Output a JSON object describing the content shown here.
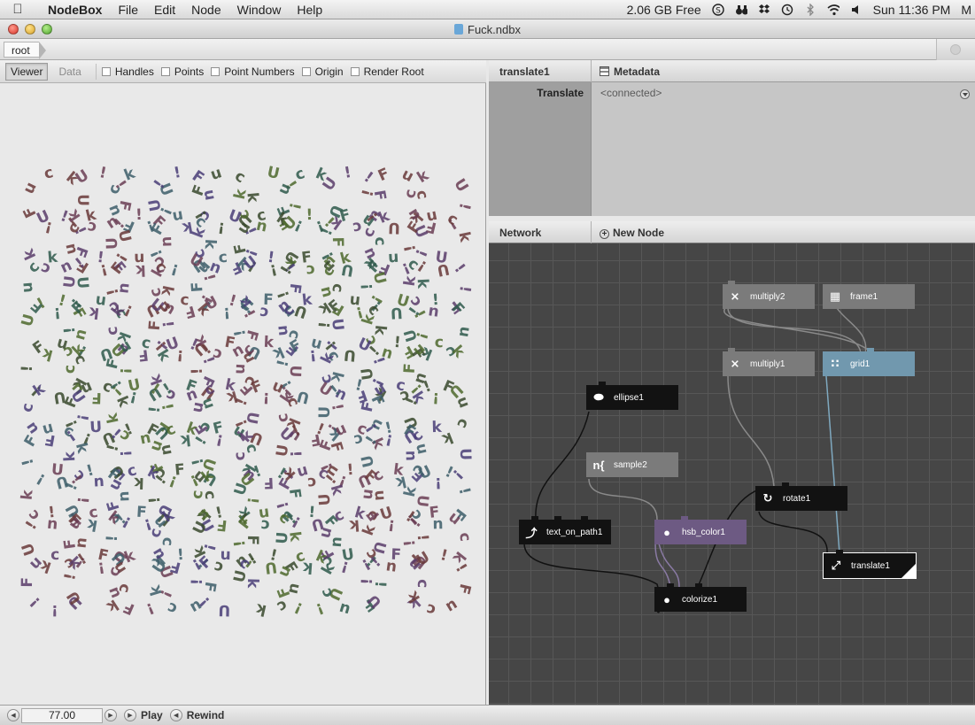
{
  "menubar": {
    "app_name": "NodeBox",
    "menus": [
      "File",
      "Edit",
      "Node",
      "Window",
      "Help"
    ],
    "memory": "2.06 GB Free",
    "clock": "Sun 11:36 PM",
    "overflow": "M"
  },
  "window": {
    "title": "Fuck.ndbx"
  },
  "breadcrumb": {
    "root": "root"
  },
  "viewer": {
    "tab_viewer": "Viewer",
    "tab_data": "Data",
    "options": [
      "Handles",
      "Points",
      "Point Numbers",
      "Origin",
      "Render Root"
    ]
  },
  "params": {
    "node_name": "translate1",
    "metadata_label": "Metadata",
    "param_label": "Translate",
    "param_value": "<connected>"
  },
  "network": {
    "title": "Network",
    "new_node": "New Node",
    "nodes": {
      "multiply2": "multiply2",
      "frame1": "frame1",
      "multiply1": "multiply1",
      "grid1": "grid1",
      "ellipse1": "ellipse1",
      "sample2": "sample2",
      "rotate1": "rotate1",
      "text_on_path1": "text_on_path1",
      "hsb_color1": "hsb_color1",
      "translate1": "translate1",
      "colorize1": "colorize1"
    }
  },
  "playback": {
    "frame": "77.00",
    "play": "Play",
    "rewind": "Rewind"
  },
  "canvas": {
    "glyph_strings": [
      "U!!Fuck",
      "Fuck U!!",
      "!!Fuck U",
      "ck U!!Fu"
    ],
    "colors": [
      "#6a3a3a",
      "#4e6a2e",
      "#3d5e6a",
      "#5a3d6b",
      "#3a4a2e",
      "#6b3e55",
      "#2f5a4c",
      "#4a3e78"
    ]
  }
}
